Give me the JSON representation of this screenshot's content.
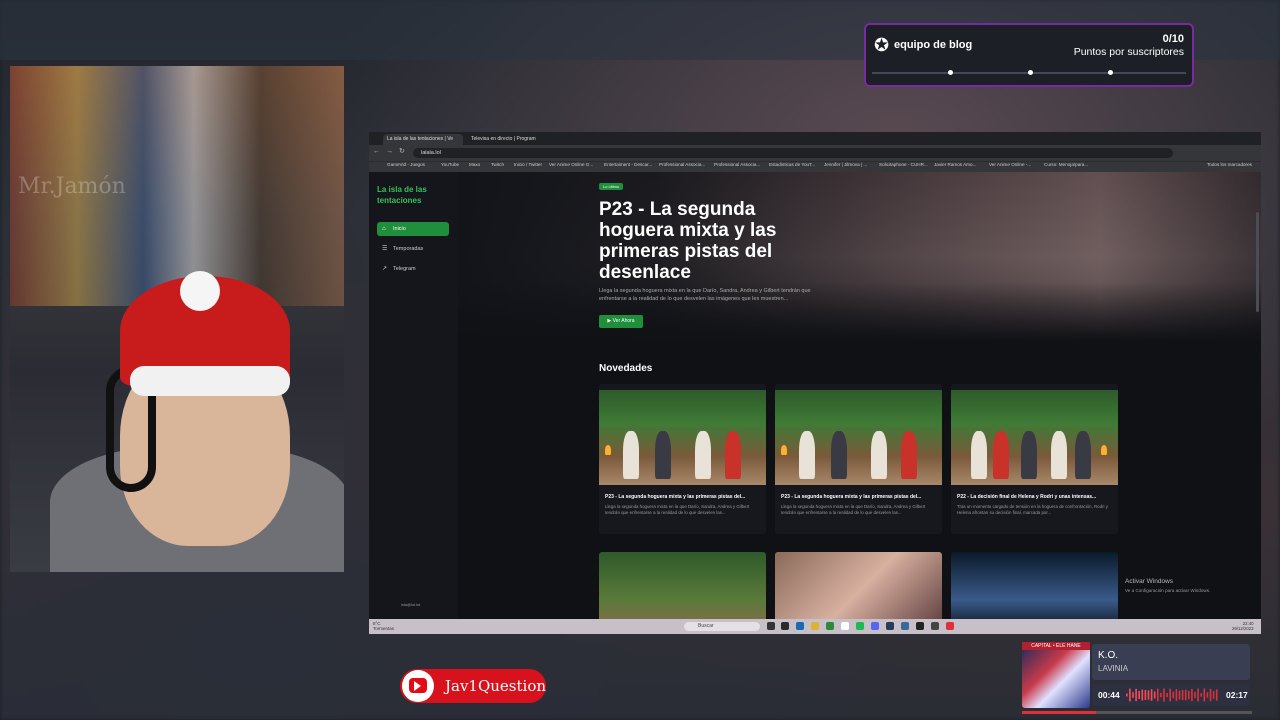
{
  "notification": {
    "title": "equipo de blog",
    "count": "0/10",
    "subtitle": "Puntos por suscriptores",
    "icon": "star-badge-icon"
  },
  "webcam": {
    "watermark": "Mr.Jamón"
  },
  "browser": {
    "tabs": [
      {
        "label": "La isla de las tentaciones | Ve"
      },
      {
        "label": "Televisa en directo | Program"
      }
    ],
    "url": "lalala.lol",
    "bookmarks": [
      "GameVid - Juegos",
      "YouTube",
      "Maxo",
      "Twitch",
      "Inicio / Twitter",
      "Ver Anime Online G...",
      "Entertaiment - Descar...",
      "Professional Associa...",
      "Professional Associa...",
      "Estadísticas de YouT...",
      "Jennifer | Jilmova | ...",
      "Solicitaphone - CUHR...",
      "Javier Ramos Amo...",
      "Ver Anime Online -...",
      "Curso: Menoja/para...",
      "Todos los marcadores"
    ]
  },
  "site": {
    "title": "La isla de las tentaciones",
    "nav": [
      {
        "label": "Inicio",
        "icon": "home-icon",
        "active": true
      },
      {
        "label": "Temporadas",
        "icon": "list-icon",
        "active": false
      },
      {
        "label": "Telegram",
        "icon": "external-link-icon",
        "active": false
      }
    ],
    "footer": "isla@lol.lol",
    "hero": {
      "badge": "Lo último",
      "title": "P23 - La segunda hoguera mixta y las primeras pistas del desenlace",
      "desc": "Llega la segunda hoguera mixta en la que Darío, Sandra, Andrea y Gilbert tendrán que enfrentarse a la realidad de lo que desvelen las imágenes que les muestren...",
      "button": "Ver Ahora"
    },
    "section_title": "Novedades",
    "cards": [
      {
        "title": "P23 - La segunda hoguera mixta y las primeras pistas del...",
        "desc": "Llega la segunda hoguera mixta en la que Darío, Sandra, Andrea y Gilbert tendrán que enfrentarse a la realidad de lo que desvelen las..."
      },
      {
        "title": "P23 - La segunda hoguera mixta y las primeras pistas del...",
        "desc": "Llega la segunda hoguera mixta en la que Darío, Sandra, Andrea y Gilbert tendrán que enfrentarse a la realidad de lo que desvelen las..."
      },
      {
        "title": "P22 - La decisión final de Helena y Rodri y unas intensas...",
        "desc": "Tras un momento cargado de tensión en la hoguera de confrontación, Rodri y Helena afrontan su decisión final, marcada por..."
      }
    ],
    "activate_title": "Activar Windows",
    "activate_desc": "Ve a Configuración para activar Windows."
  },
  "taskbar": {
    "weather": "8°C\nTormentas",
    "search": "Buscar",
    "time": "22:40\n29/12/2023"
  },
  "youtube": {
    "channel": "Jav1Question"
  },
  "music": {
    "band": "CAPITAL • ELE HANE",
    "song": "K.O.",
    "artist": "LAVINIA",
    "current": "00:44",
    "total": "02:17",
    "progress": 0.32
  },
  "colors": {
    "accent_green": "#1f8f3c",
    "title_green": "#35c05a",
    "notif_border": "#7a2aa0",
    "youtube_red": "#d8121c"
  }
}
